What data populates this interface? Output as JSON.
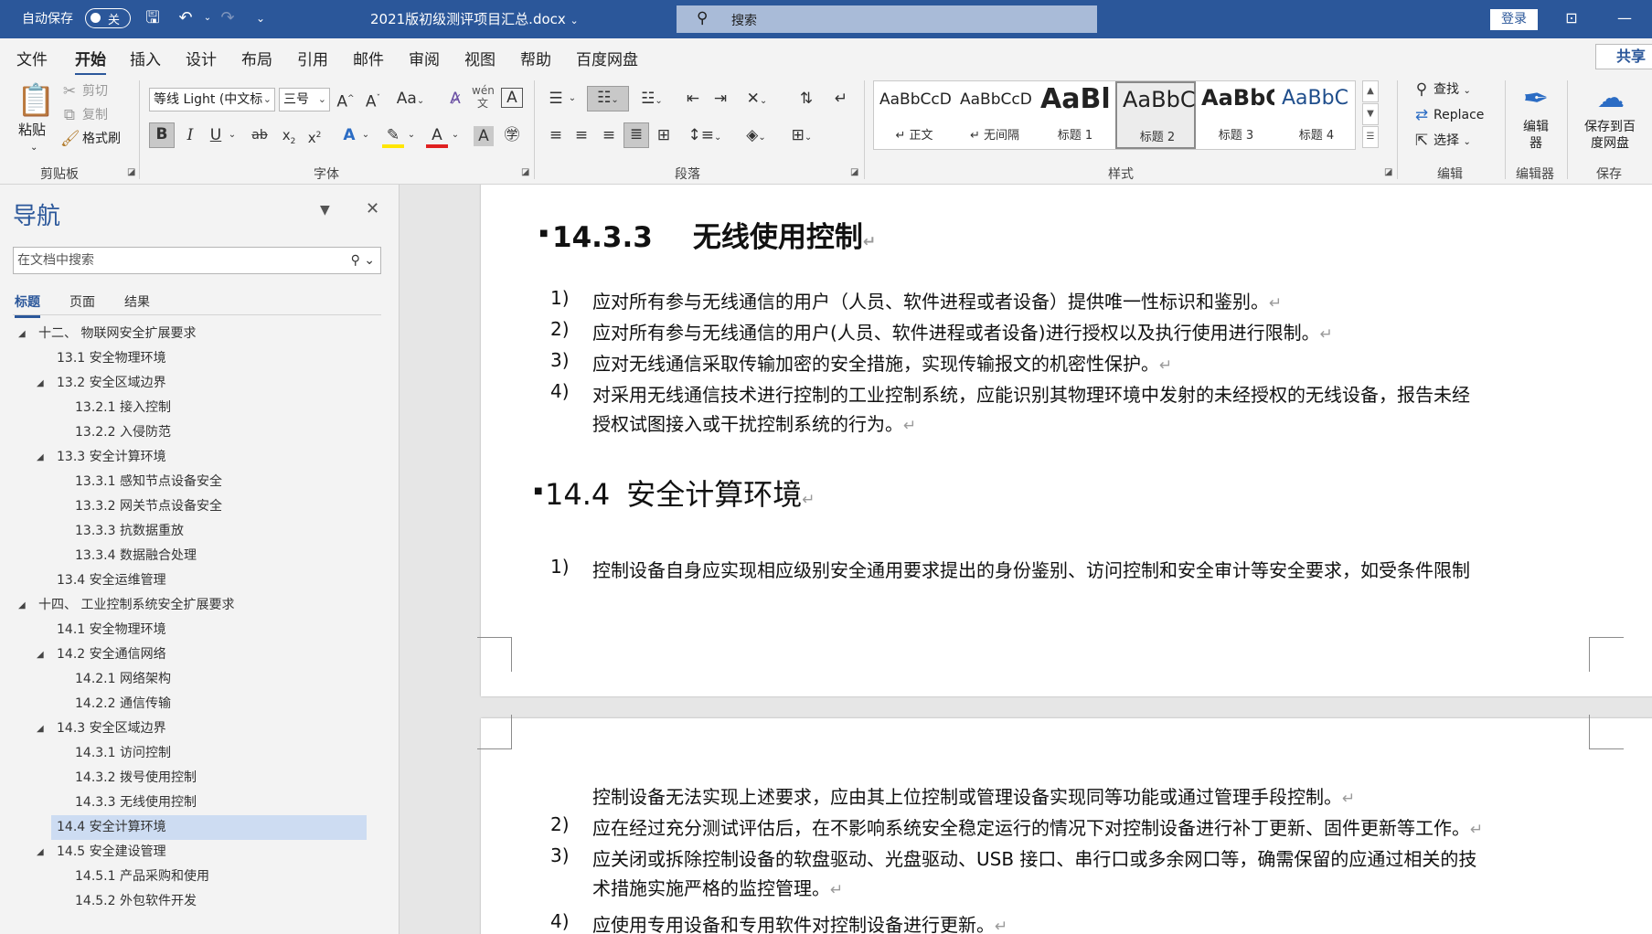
{
  "titlebar": {
    "autosave_label": "自动保存",
    "autosave_state": "关",
    "doc_title": "2021版初级测评项目汇总.docx",
    "doc_title_caret": "⌄",
    "search_placeholder": "搜索",
    "login_label": "登录"
  },
  "tabs": [
    {
      "label": "文件"
    },
    {
      "label": "开始"
    },
    {
      "label": "插入"
    },
    {
      "label": "设计"
    },
    {
      "label": "布局"
    },
    {
      "label": "引用"
    },
    {
      "label": "邮件"
    },
    {
      "label": "审阅"
    },
    {
      "label": "视图"
    },
    {
      "label": "帮助"
    },
    {
      "label": "百度网盘"
    }
  ],
  "share_label": "共享",
  "ribbon": {
    "clipboard": {
      "paste": "粘贴",
      "cut": "剪切",
      "copy": "复制",
      "format_painter": "格式刷",
      "group": "剪贴板"
    },
    "font": {
      "font_name": "等线 Light (中文标",
      "font_size": "三号",
      "group": "字体"
    },
    "paragraph": {
      "group": "段落"
    },
    "styles": {
      "items": [
        {
          "preview": "AaBbCcD",
          "name": "↵ 正文"
        },
        {
          "preview": "AaBbCcD",
          "name": "↵ 无间隔"
        },
        {
          "preview": "AaBl",
          "name": "标题 1"
        },
        {
          "preview": "AaBbC",
          "name": "标题 2"
        },
        {
          "preview": "AaBbC",
          "name": "标题 3"
        },
        {
          "preview": "AaBbC",
          "name": "标题 4"
        }
      ],
      "group": "样式"
    },
    "editing": {
      "find": "查找",
      "replace": "Replace",
      "select": "选择",
      "group": "编辑"
    },
    "editor": {
      "label": "编辑器",
      "group": "编辑器"
    },
    "save": {
      "label": "保存到百度网盘",
      "group": "保存"
    }
  },
  "nav": {
    "title": "导航",
    "search_placeholder": "在文档中搜索",
    "tabs": [
      "标题",
      "页面",
      "结果"
    ],
    "items": [
      {
        "text": "十二、 物联网安全扩展要求"
      },
      {
        "text": "13.1 安全物理环境"
      },
      {
        "text": "13.2 安全区域边界"
      },
      {
        "text": "13.2.1 接入控制"
      },
      {
        "text": "13.2.2 入侵防范"
      },
      {
        "text": "13.3 安全计算环境"
      },
      {
        "text": "13.3.1 感知节点设备安全"
      },
      {
        "text": "13.3.2 网关节点设备安全"
      },
      {
        "text": "13.3.3 抗数据重放"
      },
      {
        "text": "13.3.4 数据融合处理"
      },
      {
        "text": "13.4 安全运维管理"
      },
      {
        "text": "十四、 工业控制系统安全扩展要求"
      },
      {
        "text": "14.1 安全物理环境"
      },
      {
        "text": "14.2 安全通信网络"
      },
      {
        "text": "14.2.1 网络架构"
      },
      {
        "text": "14.2.2 通信传输"
      },
      {
        "text": "14.3 安全区域边界"
      },
      {
        "text": "14.3.1 访问控制"
      },
      {
        "text": "14.3.2 拨号使用控制"
      },
      {
        "text": "14.3.3 无线使用控制"
      },
      {
        "text": "14.4 安全计算环境"
      },
      {
        "text": "14.5 安全建设管理"
      },
      {
        "text": "14.5.1 产品采购和使用"
      },
      {
        "text": "14.5.2 外包软件开发"
      }
    ]
  },
  "document": {
    "h_1433_num": "14.3.3",
    "h_1433_title": "无线使用控制",
    "list_1433": [
      {
        "num": "1)",
        "lines": [
          "应对所有参与无线通信的用户（人员、软件进程或者设备）提供唯一性标识和鉴别。"
        ]
      },
      {
        "num": "2)",
        "lines": [
          "应对所有参与无线通信的用户(人员、软件进程或者设备)进行授权以及执行使用进行限制。"
        ]
      },
      {
        "num": "3)",
        "lines": [
          "应对无线通信采取传输加密的安全措施，实现传输报文的机密性保护。"
        ]
      },
      {
        "num": "4)",
        "lines": [
          "对采用无线通信技术进行控制的工业控制系统，应能识别其物理环境中发射的未经授权的无线设备，报告未经",
          "授权试图接入或干扰控制系统的行为。"
        ]
      }
    ],
    "h_144_num": "14.4",
    "h_144_title": "安全计算环境",
    "p1_item1_num": "1)",
    "p1_item1_line": "控制设备自身应实现相应级别安全通用要求提出的身份鉴别、访问控制和安全审计等安全要求，如受条件限制",
    "p2_cont": "控制设备无法实现上述要求，应由其上位控制或管理设备实现同等功能或通过管理手段控制。",
    "list_144_rest": [
      {
        "num": "2)",
        "lines": [
          "应在经过充分测试评估后，在不影响系统安全稳定运行的情况下对控制设备进行补丁更新、固件更新等工作。"
        ]
      },
      {
        "num": "3)",
        "lines": [
          "应关闭或拆除控制设备的软盘驱动、光盘驱动、USB 接口、串行口或多余网口等，确需保留的应通过相关的技",
          "术措施实施严格的监控管理。"
        ]
      },
      {
        "num": "4)",
        "lines": [
          "应使用专用设备和专用软件对控制设备进行更新。"
        ]
      }
    ]
  }
}
